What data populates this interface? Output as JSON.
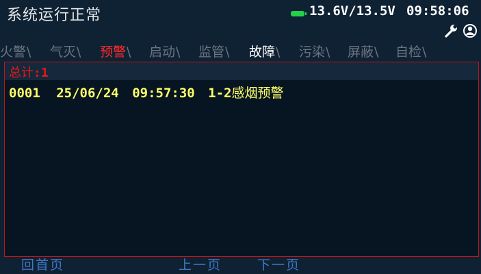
{
  "header": {
    "status": "系统运行正常",
    "voltage": "13.6V/13.5V",
    "time": "09:58:06",
    "battery_color": "#22d34a",
    "icons": [
      "battery-icon",
      "wrench-icon",
      "user-icon"
    ]
  },
  "tabs": [
    {
      "label": "火警",
      "active": false
    },
    {
      "label": "气灭",
      "active": false
    },
    {
      "label": "预警",
      "active": true
    },
    {
      "label": "启动",
      "active": false
    },
    {
      "label": "监管",
      "active": false
    },
    {
      "label": "故障",
      "active": false
    },
    {
      "label": "污染",
      "active": false
    },
    {
      "label": "屏蔽",
      "active": false
    },
    {
      "label": "自检",
      "active": false
    }
  ],
  "list": {
    "total_label": "总计",
    "total_sep": ":",
    "total_value": "1",
    "rows": [
      {
        "index": "0001",
        "date": "25/06/24",
        "time": "09:57:30",
        "address": "1-2",
        "description": "感烟预警"
      }
    ]
  },
  "footer": {
    "home": "回首页",
    "prev": "上一页",
    "next": "下一页"
  },
  "colors": {
    "accent": "#ff2a2a",
    "row_text": "#ffff66",
    "nav_text": "#3f78c6"
  }
}
